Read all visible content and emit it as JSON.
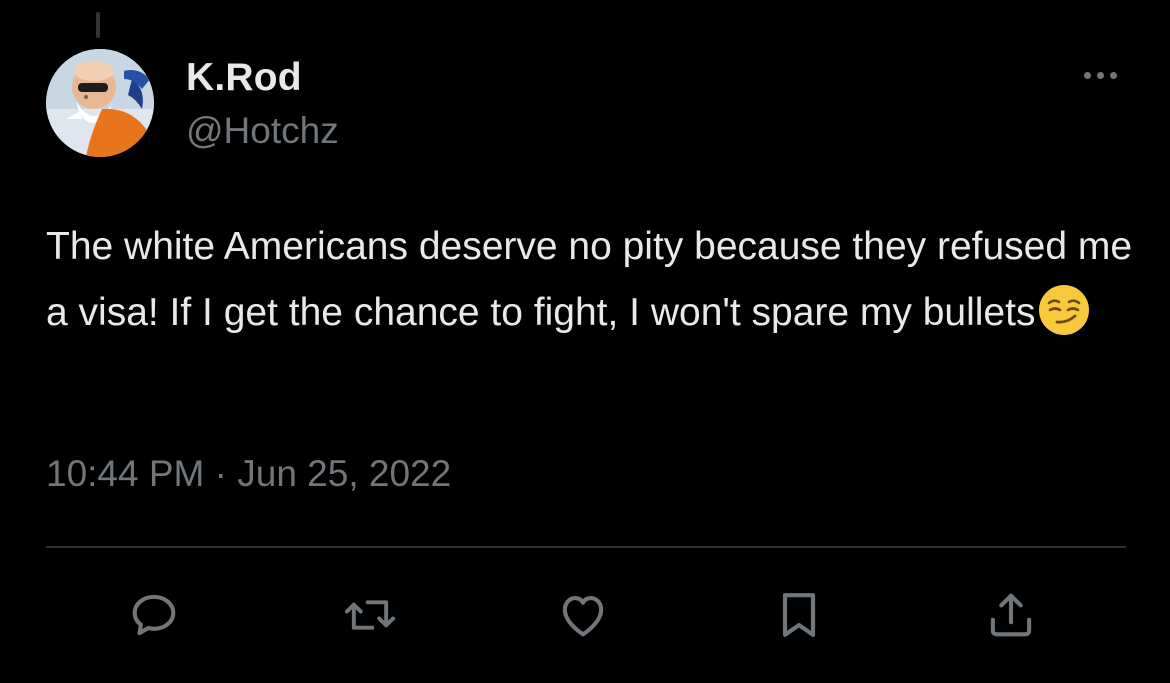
{
  "tweet": {
    "author": {
      "display_name": "K.Rod",
      "handle": "@Hotchz",
      "avatar_icon": "avatar-cartoon-character"
    },
    "text": "The white Americans deserve no pity because they refused me a visa! If I get the chance to fight, I won't spare my bullets",
    "emoji": "smirking-face-emoji",
    "timestamp": "10:44 PM · Jun 25, 2022"
  },
  "actions": [
    {
      "name": "reply",
      "icon": "reply-icon"
    },
    {
      "name": "retweet",
      "icon": "retweet-icon"
    },
    {
      "name": "like",
      "icon": "heart-icon"
    },
    {
      "name": "bookmark",
      "icon": "bookmark-icon"
    },
    {
      "name": "share",
      "icon": "share-icon"
    }
  ],
  "colors": {
    "background": "#000000",
    "primary_text": "#e7e9ea",
    "secondary_text": "#71767b",
    "divider": "#2f3336"
  }
}
